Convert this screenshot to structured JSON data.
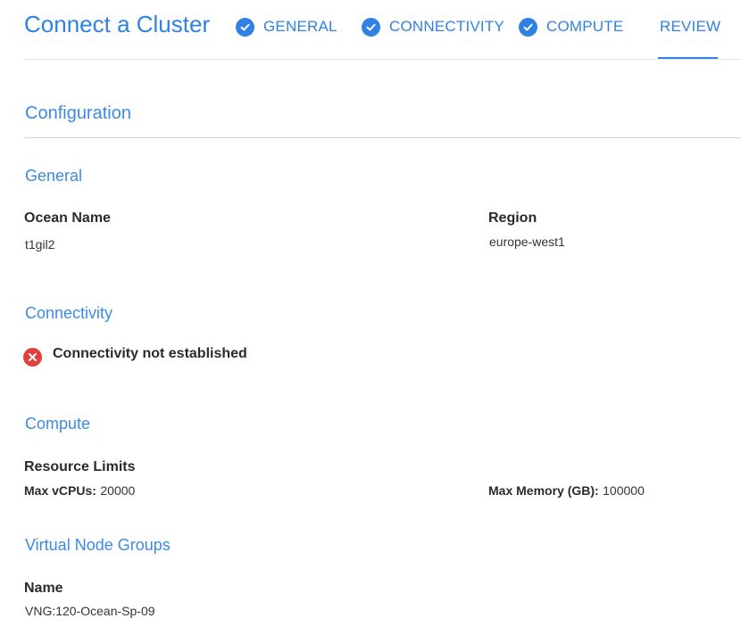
{
  "header": {
    "title": "Connect a Cluster",
    "steps": [
      {
        "label": "GENERAL",
        "completed": true
      },
      {
        "label": "CONNECTIVITY",
        "completed": true
      },
      {
        "label": "COMPUTE",
        "completed": true
      },
      {
        "label": "REVIEW",
        "completed": false,
        "active": true
      }
    ]
  },
  "configuration": {
    "heading": "Configuration",
    "general": {
      "title": "General",
      "ocean_name_label": "Ocean Name",
      "ocean_name_value": "t1gil2",
      "region_label": "Region",
      "region_value": "europe-west1"
    },
    "connectivity": {
      "title": "Connectivity",
      "status_text": "Connectivity not established",
      "status_icon": "error-x-icon",
      "status_color": "#e0413a"
    },
    "compute": {
      "title": "Compute",
      "resource_limits_label": "Resource Limits",
      "max_vcpus_label": "Max vCPUs:",
      "max_vcpus_value": "20000",
      "max_memory_label": "Max Memory (GB):",
      "max_memory_value": "100000"
    },
    "virtual_node_groups": {
      "title": "Virtual Node Groups",
      "name_label": "Name",
      "name_value": "VNG:120-Ocean-Sp-09"
    }
  },
  "colors": {
    "accent": "#2f82e4",
    "error": "#e0413a"
  }
}
